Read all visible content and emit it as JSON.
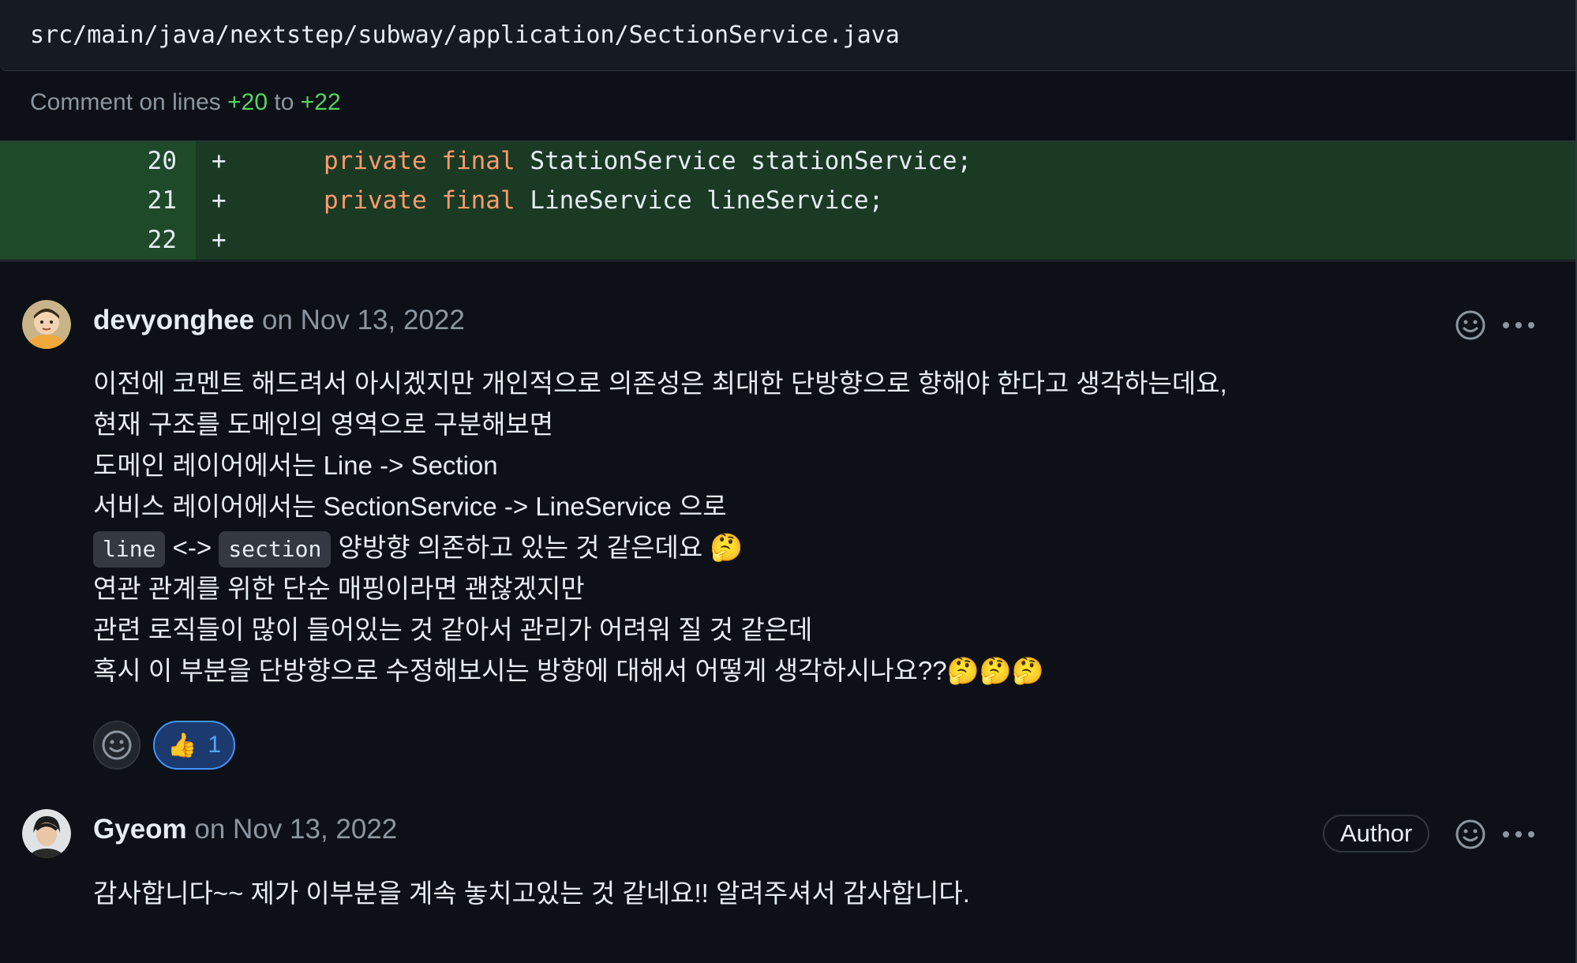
{
  "file": {
    "path": "src/main/java/nextstep/subway/application/SectionService.java",
    "comment_prefix": "Comment on lines",
    "range_start": "+20",
    "range_connector": "to",
    "range_end": "+22"
  },
  "diff": [
    {
      "line": "20",
      "sign": "+",
      "kw1": "private",
      "kw2": "final",
      "rest": "StationService stationService;"
    },
    {
      "line": "21",
      "sign": "+",
      "kw1": "private",
      "kw2": "final",
      "rest": "LineService lineService;"
    },
    {
      "line": "22",
      "sign": "+",
      "kw1": "",
      "kw2": "",
      "rest": ""
    }
  ],
  "comments": [
    {
      "author": "devyonghee",
      "date": "on Nov 13, 2022",
      "lines": [
        "이전에 코멘트 해드려서 아시겠지만 개인적으로 의존성은 최대한 단방향으로 향해야 한다고 생각하는데요,",
        "현재 구조를 도메인의 영역으로 구분해보면",
        "도메인 레이어에서는 Line -> Section",
        "서비스 레이어에서는 SectionService -> LineService 으로"
      ],
      "line5": {
        "code1": "line",
        "arrow": "<->",
        "code2": "section",
        "text": "양방향 의존하고 있는 것 같은데요",
        "emoji": "🤔"
      },
      "lines_after": [
        "연관 관계를 위한 단순 매핑이라면 괜찮겠지만",
        "관련 로직들이 많이 들어있는 것 같아서 관리가 어려워 질 것 같은데"
      ],
      "last_line": "혹시 이 부분을 단방향으로 수정해보시는 방향에 대해서 어떻게 생각하시나요??🤔🤔🤔",
      "reactions": {
        "thumbs_emoji": "👍",
        "thumbs_count": "1"
      }
    },
    {
      "author": "Gyeom",
      "date": "on Nov 13, 2022",
      "badge": "Author",
      "text": "감사합니다~~ 제가 이부분을 계속 놓치고있는 것 같네요!! 알려주셔서 감사합니다."
    }
  ],
  "icons": {
    "smiley": "smiley-icon",
    "kebab": "kebab-horizontal-icon"
  }
}
